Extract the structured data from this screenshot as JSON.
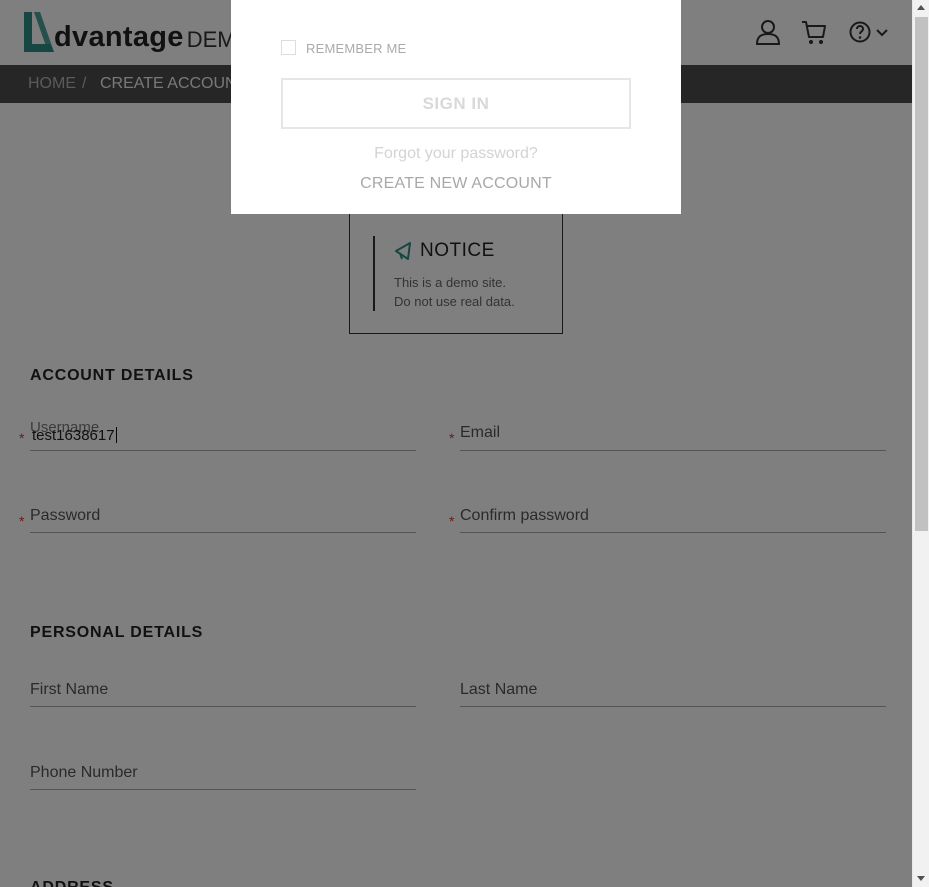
{
  "header": {
    "logo_text": "dvantage",
    "logo_suffix": "DEMO",
    "user_icon": "user-icon",
    "cart_icon": "cart-icon",
    "help_icon": "help-icon",
    "help_chevron": "chevron-down-icon"
  },
  "breadcrumb": {
    "home": "HOME",
    "separator": "/",
    "current": "CREATE ACCOUNT"
  },
  "notice": {
    "icon": "megaphone-icon",
    "title": "NOTICE",
    "line1": "This is a demo site.",
    "line2": "Do not use real data."
  },
  "account_details": {
    "title": "ACCOUNT DETAILS",
    "username_label": "Username",
    "username_value": "test1638617",
    "email_label": "Email",
    "password_label": "Password",
    "confirm_password_label": "Confirm password",
    "required_mark": "*"
  },
  "personal_details": {
    "title": "PERSONAL DETAILS",
    "first_name_label": "First Name",
    "last_name_label": "Last Name",
    "phone_label": "Phone Number"
  },
  "address": {
    "title": "ADDRESS"
  },
  "login_modal": {
    "remember_me": "REMEMBER ME",
    "sign_in": "SIGN IN",
    "forgot_password": "Forgot your password?",
    "create_new_account": "CREATE NEW ACCOUNT"
  },
  "colors": {
    "brand_teal": "#2c8f85",
    "breadcrumb_bg": "#4d4d4d",
    "required": "#dd3333"
  }
}
